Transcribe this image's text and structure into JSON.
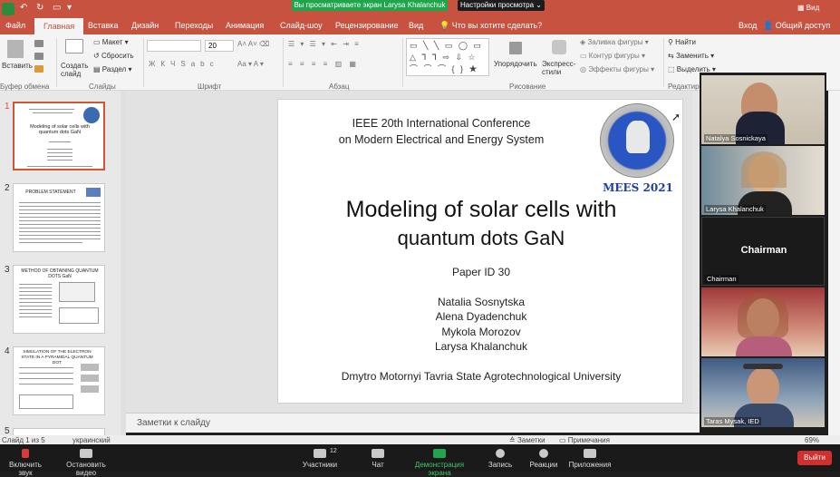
{
  "zoom": {
    "share_banner": "Вы просматриваете экран Larysa Khalanchuk",
    "view_options": "Настройки просмотра ⌄",
    "view_label": "Вид",
    "controls": [
      {
        "label": "Включить звук",
        "icon": "mic-muted-icon"
      },
      {
        "label": "Остановить видео",
        "icon": "video-icon"
      },
      {
        "label": "Участники",
        "icon": "participants-icon",
        "count": "12"
      },
      {
        "label": "Чат",
        "icon": "chat-icon"
      },
      {
        "label": "Демонстрация экрана",
        "icon": "share-screen-icon"
      },
      {
        "label": "Запись",
        "icon": "record-icon"
      },
      {
        "label": "Реакции",
        "icon": "reactions-icon"
      },
      {
        "label": "Приложения",
        "icon": "apps-icon"
      }
    ],
    "exit_label": "Выйти",
    "participants": [
      {
        "name": "Natalya Sosnickaya"
      },
      {
        "name": "Larysa Khalanchuk"
      },
      {
        "name": "Chairman",
        "center_text": "Chairman"
      },
      {
        "name": ""
      },
      {
        "name": "Taras Mysak, IED"
      }
    ]
  },
  "ppt": {
    "menu_tabs": [
      "Файл",
      "Главная",
      "Вставка",
      "Дизайн",
      "Переходы",
      "Анимация",
      "Слайд-шоу",
      "Рецензирование",
      "Вид"
    ],
    "active_tab": "Главная",
    "tell_me": "Что вы хотите сделать?",
    "signin": "Вход",
    "share": "Общий доступ",
    "ribbon": {
      "paste": "Вставить",
      "clipboard_group": "Буфер обмена",
      "new_slide": "Создать слайд",
      "layout": "Макет",
      "reset": "Сбросить",
      "section": "Раздел",
      "slides_group": "Слайды",
      "font_size": "20",
      "font_group": "Шрифт",
      "paragraph_group": "Абзац",
      "arrange": "Упорядочить",
      "quick_styles": "Экспресс-стили",
      "shape_fill": "Заливка фигуры",
      "shape_outline": "Контур фигуры",
      "shape_effects": "Эффекты фигуры",
      "drawing_group": "Рисование",
      "find": "Найти",
      "replace": "Заменить",
      "select": "Выделить",
      "editing_group": "Редактиро"
    },
    "thumbnails": [
      {
        "num": "1",
        "title": "Modeling of solar cells with quantum dots GaN"
      },
      {
        "num": "2",
        "title": "PROBLEM STATEMENT"
      },
      {
        "num": "3",
        "title": "METHOD OF OBTAINING QUANTUM DOTS GaN"
      },
      {
        "num": "4",
        "title": "SIMULATION OF THE ELECTRON STATE IN A PYRAMIDAL QUANTUM DOT"
      },
      {
        "num": "5",
        "title": ""
      }
    ],
    "slide": {
      "conf_line1": "IEEE 20th International Conference",
      "conf_line2": "on Modern Electrical and Energy System",
      "logo_text": "MEES 2021",
      "title_line1": "Modeling of solar cells with",
      "title_line2": "quantum dots GaN",
      "paper_id": "Paper ID 30",
      "authors": [
        "Natalia Sosnytska",
        "Alena Dyadenchuk",
        "Mykola Morozov",
        "Larysa Khalanchuk"
      ],
      "university": "Dmytro Motornyi Tavria State Agrotechnological University"
    },
    "notes_placeholder": "Заметки к слайду",
    "status": {
      "slide_of": "Слайд 1 из 5",
      "language": "украинский",
      "notes_btn": "Заметки",
      "comments_btn": "Примечания",
      "zoom_level": "69%"
    }
  },
  "colors": {
    "ppt_accent": "#c6523f",
    "zoom_green": "#1fa54a",
    "logo_blue": "#1f3fa0"
  }
}
